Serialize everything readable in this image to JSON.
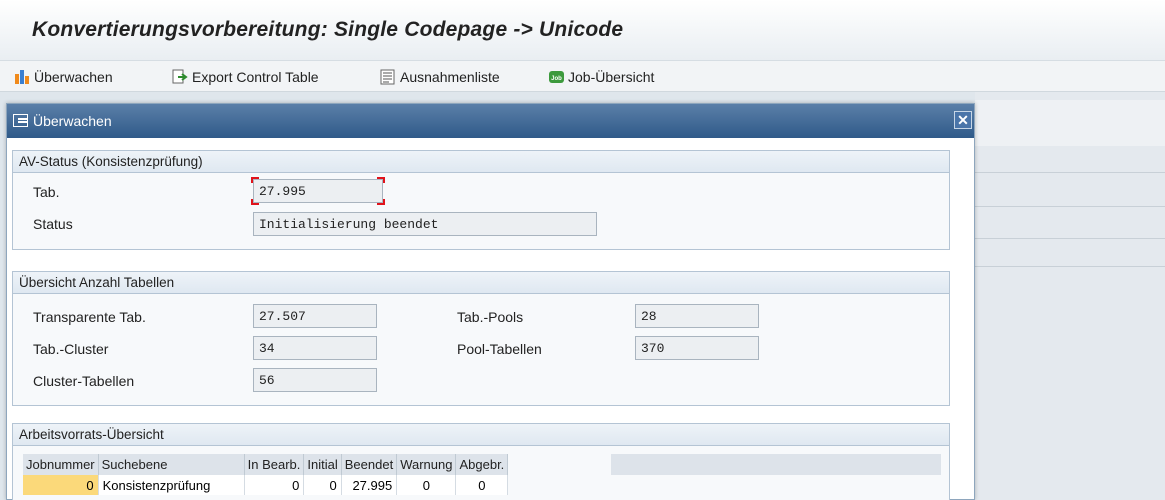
{
  "window": {
    "title": "Konvertierungsvorbereitung: Single Codepage -> Unicode"
  },
  "toolbar": {
    "items": [
      {
        "label": "Überwachen",
        "icon": "monitor-chart-icon"
      },
      {
        "label": "Export Control Table",
        "icon": "export-icon"
      },
      {
        "label": "Ausnahmenliste",
        "icon": "list-icon"
      },
      {
        "label": "Job-Übersicht",
        "icon": "job-icon"
      }
    ]
  },
  "dialog": {
    "title": "Überwachen",
    "status_group": {
      "title": "AV-Status (Konsistenzprüfung)",
      "tab_label": "Tab.",
      "tab_value": "27.995",
      "status_label": "Status",
      "status_value": "Initialisierung beendet"
    },
    "overview_group": {
      "title": "Übersicht Anzahl Tabellen",
      "transparent_label": "Transparente Tab.",
      "transparent_value": "27.507",
      "cluster_label": "Tab.-Cluster",
      "cluster_value": "34",
      "cluster_tables_label": "Cluster-Tabellen",
      "cluster_tables_value": "56",
      "pools_label": "Tab.-Pools",
      "pools_value": "28",
      "pool_tables_label": "Pool-Tabellen",
      "pool_tables_value": "370"
    },
    "work_group": {
      "title": "Arbeitsvorrats-Übersicht",
      "columns": [
        "Jobnummer",
        "Suchebene",
        "In Bearb.",
        "Initial",
        "Beendet",
        "Warnung",
        "Abgebr."
      ],
      "rows": [
        [
          "0",
          "Konsistenzprüfung",
          "0",
          "0",
          "27.995",
          "0",
          "0"
        ]
      ]
    }
  },
  "colors": {
    "dialog_header": "#2f5a89",
    "focus": "#e0131b",
    "selected_cell": "#fbd97a"
  }
}
